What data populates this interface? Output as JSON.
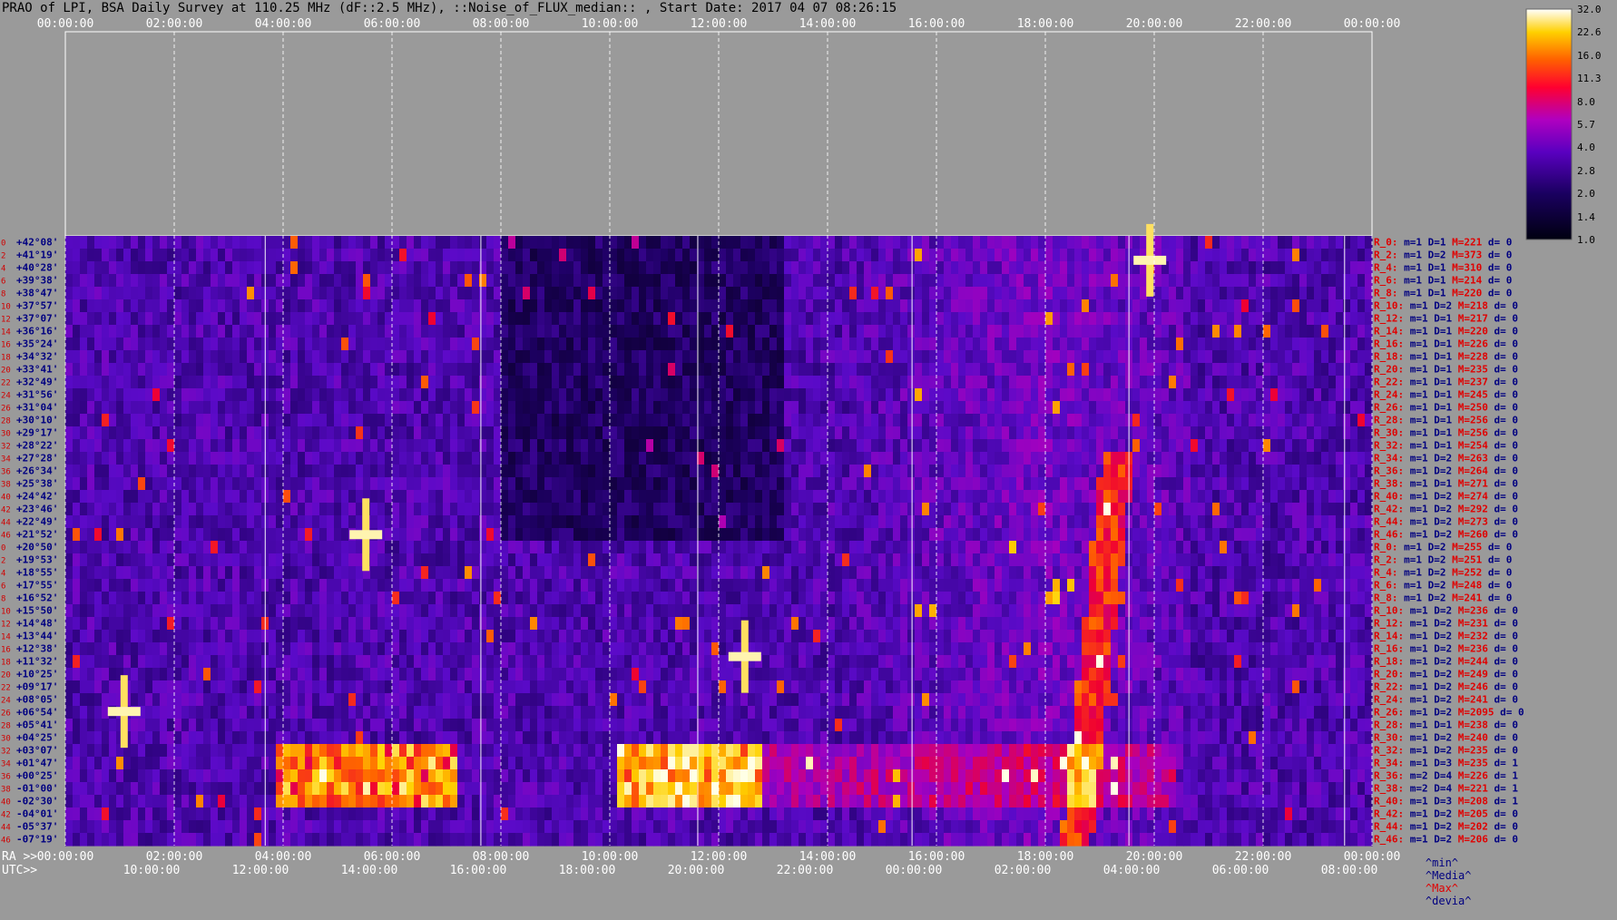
{
  "title": "PRAO of LPI, BSA Daily Survey at 110.25 MHz (dF::2.5 MHz), ::Noise_of_FLUX_median:: , Start Date: 2017 04 07 08:26:15",
  "colors": {
    "background": "#9a9a9a",
    "right_label_red": "#e00000",
    "right_label_blue": "#000080",
    "dec_label": "#000080",
    "row_index": "#d00000"
  },
  "chart_data": {
    "type": "heatmap",
    "title": "PRAO of LPI, BSA Daily Survey at 110.25 MHz (dF::2.5 MHz), ::Noise_of_FLUX_median:: , Start Date: 2017 04 07 08:26:15",
    "x_ra_ticks": [
      "00:00:00",
      "02:00:00",
      "04:00:00",
      "06:00:00",
      "08:00:00",
      "10:00:00",
      "12:00:00",
      "14:00:00",
      "16:00:00",
      "18:00:00",
      "20:00:00",
      "22:00:00",
      "00:00:00"
    ],
    "x_utc_ticks": [
      "10:00:00",
      "12:00:00",
      "14:00:00",
      "16:00:00",
      "18:00:00",
      "20:00:00",
      "22:00:00",
      "00:00:00",
      "02:00:00",
      "04:00:00",
      "06:00:00",
      "08:00:00"
    ],
    "ra_axis_label": "RA >>",
    "utc_axis_label": "UTC>>",
    "colorbar_ticks": [
      "32.0",
      "22.6",
      "16.0",
      "11.3",
      "8.0",
      "5.7",
      "4.0",
      "2.8",
      "2.0",
      "1.4",
      "1.0"
    ],
    "rows": [
      {
        "idx": "0",
        "dec": "+42°08'",
        "r": "R_0:",
        "m": "m=1",
        "d": "D=1",
        "M": "M=221",
        "dv": "d= 0"
      },
      {
        "idx": "2",
        "dec": "+41°19'",
        "r": "R_2:",
        "m": "m=1",
        "d": "D=2",
        "M": "M=373",
        "dv": "d= 0"
      },
      {
        "idx": "4",
        "dec": "+40°28'",
        "r": "R_4:",
        "m": "m=1",
        "d": "D=1",
        "M": "M=310",
        "dv": "d= 0"
      },
      {
        "idx": "6",
        "dec": "+39°38'",
        "r": "R_6:",
        "m": "m=1",
        "d": "D=1",
        "M": "M=214",
        "dv": "d= 0"
      },
      {
        "idx": "8",
        "dec": "+38°47'",
        "r": "R_8:",
        "m": "m=1",
        "d": "D=1",
        "M": "M=220",
        "dv": "d= 0"
      },
      {
        "idx": "10",
        "dec": "+37°57'",
        "r": "R_10:",
        "m": "m=1",
        "d": "D=2",
        "M": "M=218",
        "dv": "d= 0"
      },
      {
        "idx": "12",
        "dec": "+37°07'",
        "r": "R_12:",
        "m": "m=1",
        "d": "D=1",
        "M": "M=217",
        "dv": "d= 0"
      },
      {
        "idx": "14",
        "dec": "+36°16'",
        "r": "R_14:",
        "m": "m=1",
        "d": "D=1",
        "M": "M=220",
        "dv": "d= 0"
      },
      {
        "idx": "16",
        "dec": "+35°24'",
        "r": "R_16:",
        "m": "m=1",
        "d": "D=1",
        "M": "M=226",
        "dv": "d= 0"
      },
      {
        "idx": "18",
        "dec": "+34°32'",
        "r": "R_18:",
        "m": "m=1",
        "d": "D=1",
        "M": "M=228",
        "dv": "d= 0"
      },
      {
        "idx": "20",
        "dec": "+33°41'",
        "r": "R_20:",
        "m": "m=1",
        "d": "D=1",
        "M": "M=235",
        "dv": "d= 0"
      },
      {
        "idx": "22",
        "dec": "+32°49'",
        "r": "R_22:",
        "m": "m=1",
        "d": "D=1",
        "M": "M=237",
        "dv": "d= 0"
      },
      {
        "idx": "24",
        "dec": "+31°56'",
        "r": "R_24:",
        "m": "m=1",
        "d": "D=1",
        "M": "M=245",
        "dv": "d= 0"
      },
      {
        "idx": "26",
        "dec": "+31°04'",
        "r": "R_26:",
        "m": "m=1",
        "d": "D=1",
        "M": "M=250",
        "dv": "d= 0"
      },
      {
        "idx": "28",
        "dec": "+30°10'",
        "r": "R_28:",
        "m": "m=1",
        "d": "D=1",
        "M": "M=256",
        "dv": "d= 0"
      },
      {
        "idx": "30",
        "dec": "+29°17'",
        "r": "R_30:",
        "m": "m=1",
        "d": "D=1",
        "M": "M=256",
        "dv": "d= 0"
      },
      {
        "idx": "32",
        "dec": "+28°22'",
        "r": "R_32:",
        "m": "m=1",
        "d": "D=1",
        "M": "M=254",
        "dv": "d= 0"
      },
      {
        "idx": "34",
        "dec": "+27°28'",
        "r": "R_34:",
        "m": "m=1",
        "d": "D=2",
        "M": "M=263",
        "dv": "d= 0"
      },
      {
        "idx": "36",
        "dec": "+26°34'",
        "r": "R_36:",
        "m": "m=1",
        "d": "D=2",
        "M": "M=264",
        "dv": "d= 0"
      },
      {
        "idx": "38",
        "dec": "+25°38'",
        "r": "R_38:",
        "m": "m=1",
        "d": "D=1",
        "M": "M=271",
        "dv": "d= 0"
      },
      {
        "idx": "40",
        "dec": "+24°42'",
        "r": "R_40:",
        "m": "m=1",
        "d": "D=2",
        "M": "M=274",
        "dv": "d= 0"
      },
      {
        "idx": "42",
        "dec": "+23°46'",
        "r": "R_42:",
        "m": "m=1",
        "d": "D=2",
        "M": "M=292",
        "dv": "d= 0"
      },
      {
        "idx": "44",
        "dec": "+22°49'",
        "r": "R_44:",
        "m": "m=1",
        "d": "D=2",
        "M": "M=273",
        "dv": "d= 0"
      },
      {
        "idx": "46",
        "dec": "+21°52'",
        "r": "R_46:",
        "m": "m=1",
        "d": "D=2",
        "M": "M=260",
        "dv": "d= 0"
      },
      {
        "idx": "0",
        "dec": "+20°50'",
        "r": "R_0:",
        "m": "m=1",
        "d": "D=2",
        "M": "M=255",
        "dv": "d= 0"
      },
      {
        "idx": "2",
        "dec": "+19°53'",
        "r": "R_2:",
        "m": "m=1",
        "d": "D=2",
        "M": "M=251",
        "dv": "d= 0"
      },
      {
        "idx": "4",
        "dec": "+18°55'",
        "r": "R_4:",
        "m": "m=1",
        "d": "D=2",
        "M": "M=252",
        "dv": "d= 0"
      },
      {
        "idx": "6",
        "dec": "+17°55'",
        "r": "R_6:",
        "m": "m=1",
        "d": "D=2",
        "M": "M=248",
        "dv": "d= 0"
      },
      {
        "idx": "8",
        "dec": "+16°52'",
        "r": "R_8:",
        "m": "m=1",
        "d": "D=2",
        "M": "M=241",
        "dv": "d= 0"
      },
      {
        "idx": "10",
        "dec": "+15°50'",
        "r": "R_10:",
        "m": "m=1",
        "d": "D=2",
        "M": "M=236",
        "dv": "d= 0"
      },
      {
        "idx": "12",
        "dec": "+14°48'",
        "r": "R_12:",
        "m": "m=1",
        "d": "D=2",
        "M": "M=231",
        "dv": "d= 0"
      },
      {
        "idx": "14",
        "dec": "+13°44'",
        "r": "R_14:",
        "m": "m=1",
        "d": "D=2",
        "M": "M=232",
        "dv": "d= 0"
      },
      {
        "idx": "16",
        "dec": "+12°38'",
        "r": "R_16:",
        "m": "m=1",
        "d": "D=2",
        "M": "M=236",
        "dv": "d= 0"
      },
      {
        "idx": "18",
        "dec": "+11°32'",
        "r": "R_18:",
        "m": "m=1",
        "d": "D=2",
        "M": "M=244",
        "dv": "d= 0"
      },
      {
        "idx": "20",
        "dec": "+10°25'",
        "r": "R_20:",
        "m": "m=1",
        "d": "D=2",
        "M": "M=249",
        "dv": "d= 0"
      },
      {
        "idx": "22",
        "dec": "+09°17'",
        "r": "R_22:",
        "m": "m=1",
        "d": "D=2",
        "M": "M=246",
        "dv": "d= 0"
      },
      {
        "idx": "24",
        "dec": "+08°05'",
        "r": "R_24:",
        "m": "m=1",
        "d": "D=2",
        "M": "M=241",
        "dv": "d= 0"
      },
      {
        "idx": "26",
        "dec": "+06°54'",
        "r": "R_26:",
        "m": "m=1",
        "d": "D=2",
        "M": "M=2095",
        "dv": "d= 0"
      },
      {
        "idx": "28",
        "dec": "+05°41'",
        "r": "R_28:",
        "m": "m=1",
        "d": "D=1",
        "M": "M=238",
        "dv": "d= 0"
      },
      {
        "idx": "30",
        "dec": "+04°25'",
        "r": "R_30:",
        "m": "m=1",
        "d": "D=2",
        "M": "M=240",
        "dv": "d= 0"
      },
      {
        "idx": "32",
        "dec": "+03°07'",
        "r": "R_32:",
        "m": "m=1",
        "d": "D=2",
        "M": "M=235",
        "dv": "d= 0"
      },
      {
        "idx": "34",
        "dec": "+01°47'",
        "r": "R_34:",
        "m": "m=1",
        "d": "D=3",
        "M": "M=235",
        "dv": "d= 1"
      },
      {
        "idx": "36",
        "dec": "+00°25'",
        "r": "R_36:",
        "m": "m=2",
        "d": "D=4",
        "M": "M=226",
        "dv": "d= 1"
      },
      {
        "idx": "38",
        "dec": "-01°00'",
        "r": "R_38:",
        "m": "m=2",
        "d": "D=4",
        "M": "M=221",
        "dv": "d= 1"
      },
      {
        "idx": "40",
        "dec": "-02°30'",
        "r": "R_40:",
        "m": "m=1",
        "d": "D=3",
        "M": "M=208",
        "dv": "d= 1"
      },
      {
        "idx": "42",
        "dec": "-04°01'",
        "r": "R_42:",
        "m": "m=1",
        "d": "D=2",
        "M": "M=205",
        "dv": "d= 0"
      },
      {
        "idx": "44",
        "dec": "-05°37'",
        "r": "R_44:",
        "m": "m=1",
        "d": "D=2",
        "M": "M=202",
        "dv": "d= 0"
      },
      {
        "idx": "46",
        "dec": "-07°19'",
        "r": "R_46:",
        "m": "m=1",
        "d": "D=2",
        "M": "M=206",
        "dv": "d= 0"
      }
    ]
  },
  "legend_keys": {
    "min": "^min^",
    "media": "^Media^",
    "max": "^Max^",
    "devia": "^devia^"
  }
}
